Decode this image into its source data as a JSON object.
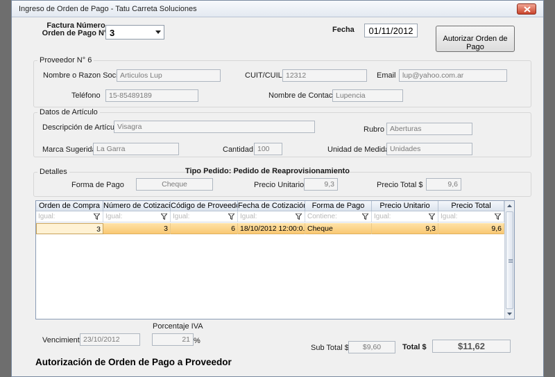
{
  "window": {
    "title": "Ingreso de Orden de Pago - Tatu Carreta Soluciones"
  },
  "header": {
    "factura_label_line1": "Factura Número",
    "factura_label_line2": "Orden de Pago N°",
    "factura_value": "3",
    "fecha_label": "Fecha",
    "fecha_value": "01/11/2012",
    "authorize_button": "Autorizar Orden de Pago"
  },
  "proveedor": {
    "group_title": "Proveedor N° 6",
    "nombre_label": "Nombre o Razon Social",
    "nombre_value": "Articulos Lup",
    "cuit_label": "CUIT/CUIL",
    "cuit_value": "12312",
    "email_label": "Email",
    "email_value": "lup@yahoo.com.ar",
    "telefono_label": "Teléfono",
    "telefono_value": "15-85489189",
    "contacto_label": "Nombre de Contacto",
    "contacto_value": "Lupencia"
  },
  "articulo": {
    "group_title": "Datos de Artículo",
    "descripcion_label": "Descripción de Artículo",
    "descripcion_value": "Visagra",
    "rubro_label": "Rubro",
    "rubro_value": "Aberturas",
    "marca_label": "Marca Sugerida",
    "marca_value": "La Garra",
    "cantidad_label": "Cantidad",
    "cantidad_value": "100",
    "unidad_label": "Unidad de Medida",
    "unidad_value": "Unidades"
  },
  "detalles": {
    "group_title": "Detalles",
    "tipo_pedido": "Tipo Pedido: Pedido de Reaprovisionamiento",
    "forma_pago_label": "Forma de Pago",
    "forma_pago_value": "Cheque",
    "precio_unitario_label": "Precio Unitario $",
    "precio_unitario_value": "9,3",
    "precio_total_label": "Precio Total  $",
    "precio_total_value": "9,6"
  },
  "grid": {
    "columns": [
      "Orden de Compra",
      "Número de Cotizaci...",
      "Código de Proveedor",
      "Fecha de Cotización",
      "Forma de Pago",
      "Precio Unitario",
      "Precio Total"
    ],
    "filters": [
      "Igual:",
      "Igual:",
      "Igual:",
      "Igual:",
      "Contiene:",
      "Igual:",
      "Igual:"
    ],
    "rows": [
      [
        "3",
        "3",
        "6",
        "18/10/2012  12:00:0...",
        "Cheque",
        "9,3",
        "9,6"
      ]
    ]
  },
  "footer": {
    "porcentaje_iva_label": "Porcentaje IVA",
    "porcentaje_iva_value": "21",
    "percent_sign": "%",
    "vencimiento_label": "Vencimiento",
    "vencimiento_value": "23/10/2012",
    "subtotal_label": "Sub Total $",
    "subtotal_value": "$9,60",
    "total_label": "Total $",
    "total_value": "$11,62",
    "form_title": "Autorización de Orden de Pago a Proveedor"
  }
}
